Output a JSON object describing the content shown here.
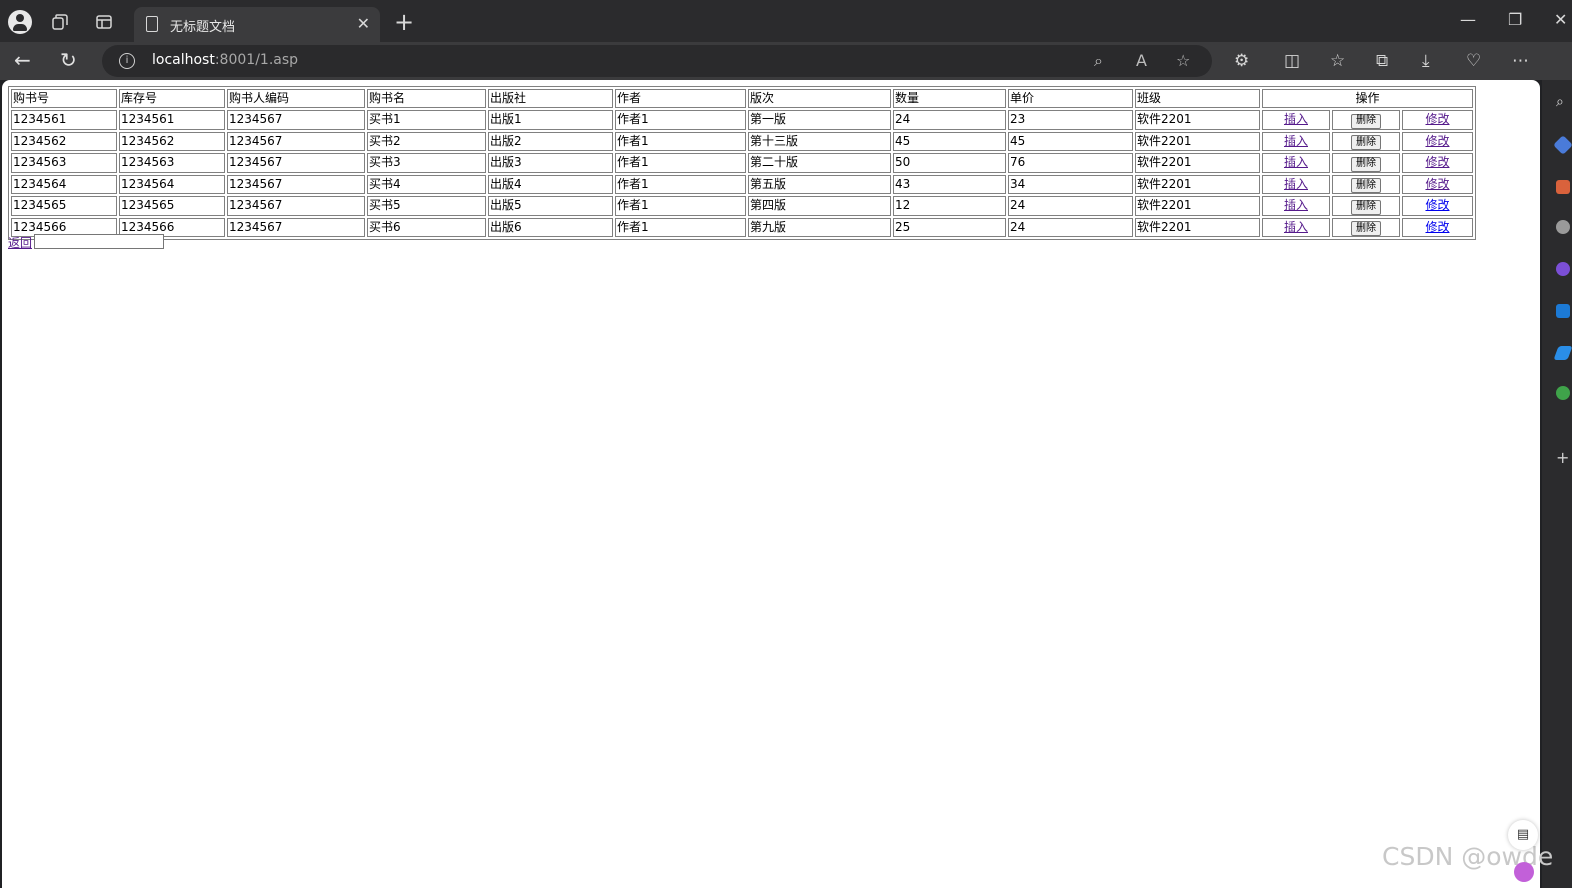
{
  "browser": {
    "tab_title": "无标题文档",
    "url_host": "localhost",
    "url_path": ":8001/1.asp"
  },
  "table": {
    "headers": [
      "购书号",
      "库存号",
      "购书人编码",
      "购书名",
      "出版社",
      "作者",
      "版次",
      "数量",
      "单价",
      "班级",
      "操作"
    ],
    "rows": [
      [
        "1234561",
        "1234561",
        "1234567",
        "买书1",
        "出版1",
        "作者1",
        "第一版",
        "24",
        "23",
        "软件2201"
      ],
      [
        "1234562",
        "1234562",
        "1234567",
        "买书2",
        "出版2",
        "作者1",
        "第十三版",
        "45",
        "45",
        "软件2201"
      ],
      [
        "1234563",
        "1234563",
        "1234567",
        "买书3",
        "出版3",
        "作者1",
        "第二十版",
        "50",
        "76",
        "软件2201"
      ],
      [
        "1234564",
        "1234564",
        "1234567",
        "买书4",
        "出版4",
        "作者1",
        "第五版",
        "43",
        "34",
        "软件2201"
      ],
      [
        "1234565",
        "1234565",
        "1234567",
        "买书5",
        "出版5",
        "作者1",
        "第四版",
        "12",
        "24",
        "软件2201"
      ],
      [
        "1234566",
        "1234566",
        "1234567",
        "买书6",
        "出版6",
        "作者1",
        "第九版",
        "25",
        "24",
        "软件2201"
      ]
    ],
    "actions": {
      "insert": "插入",
      "delete": "删除",
      "modify": "修改"
    }
  },
  "back_link": "返回",
  "back_input_value": "",
  "watermark": "CSDN @owde"
}
